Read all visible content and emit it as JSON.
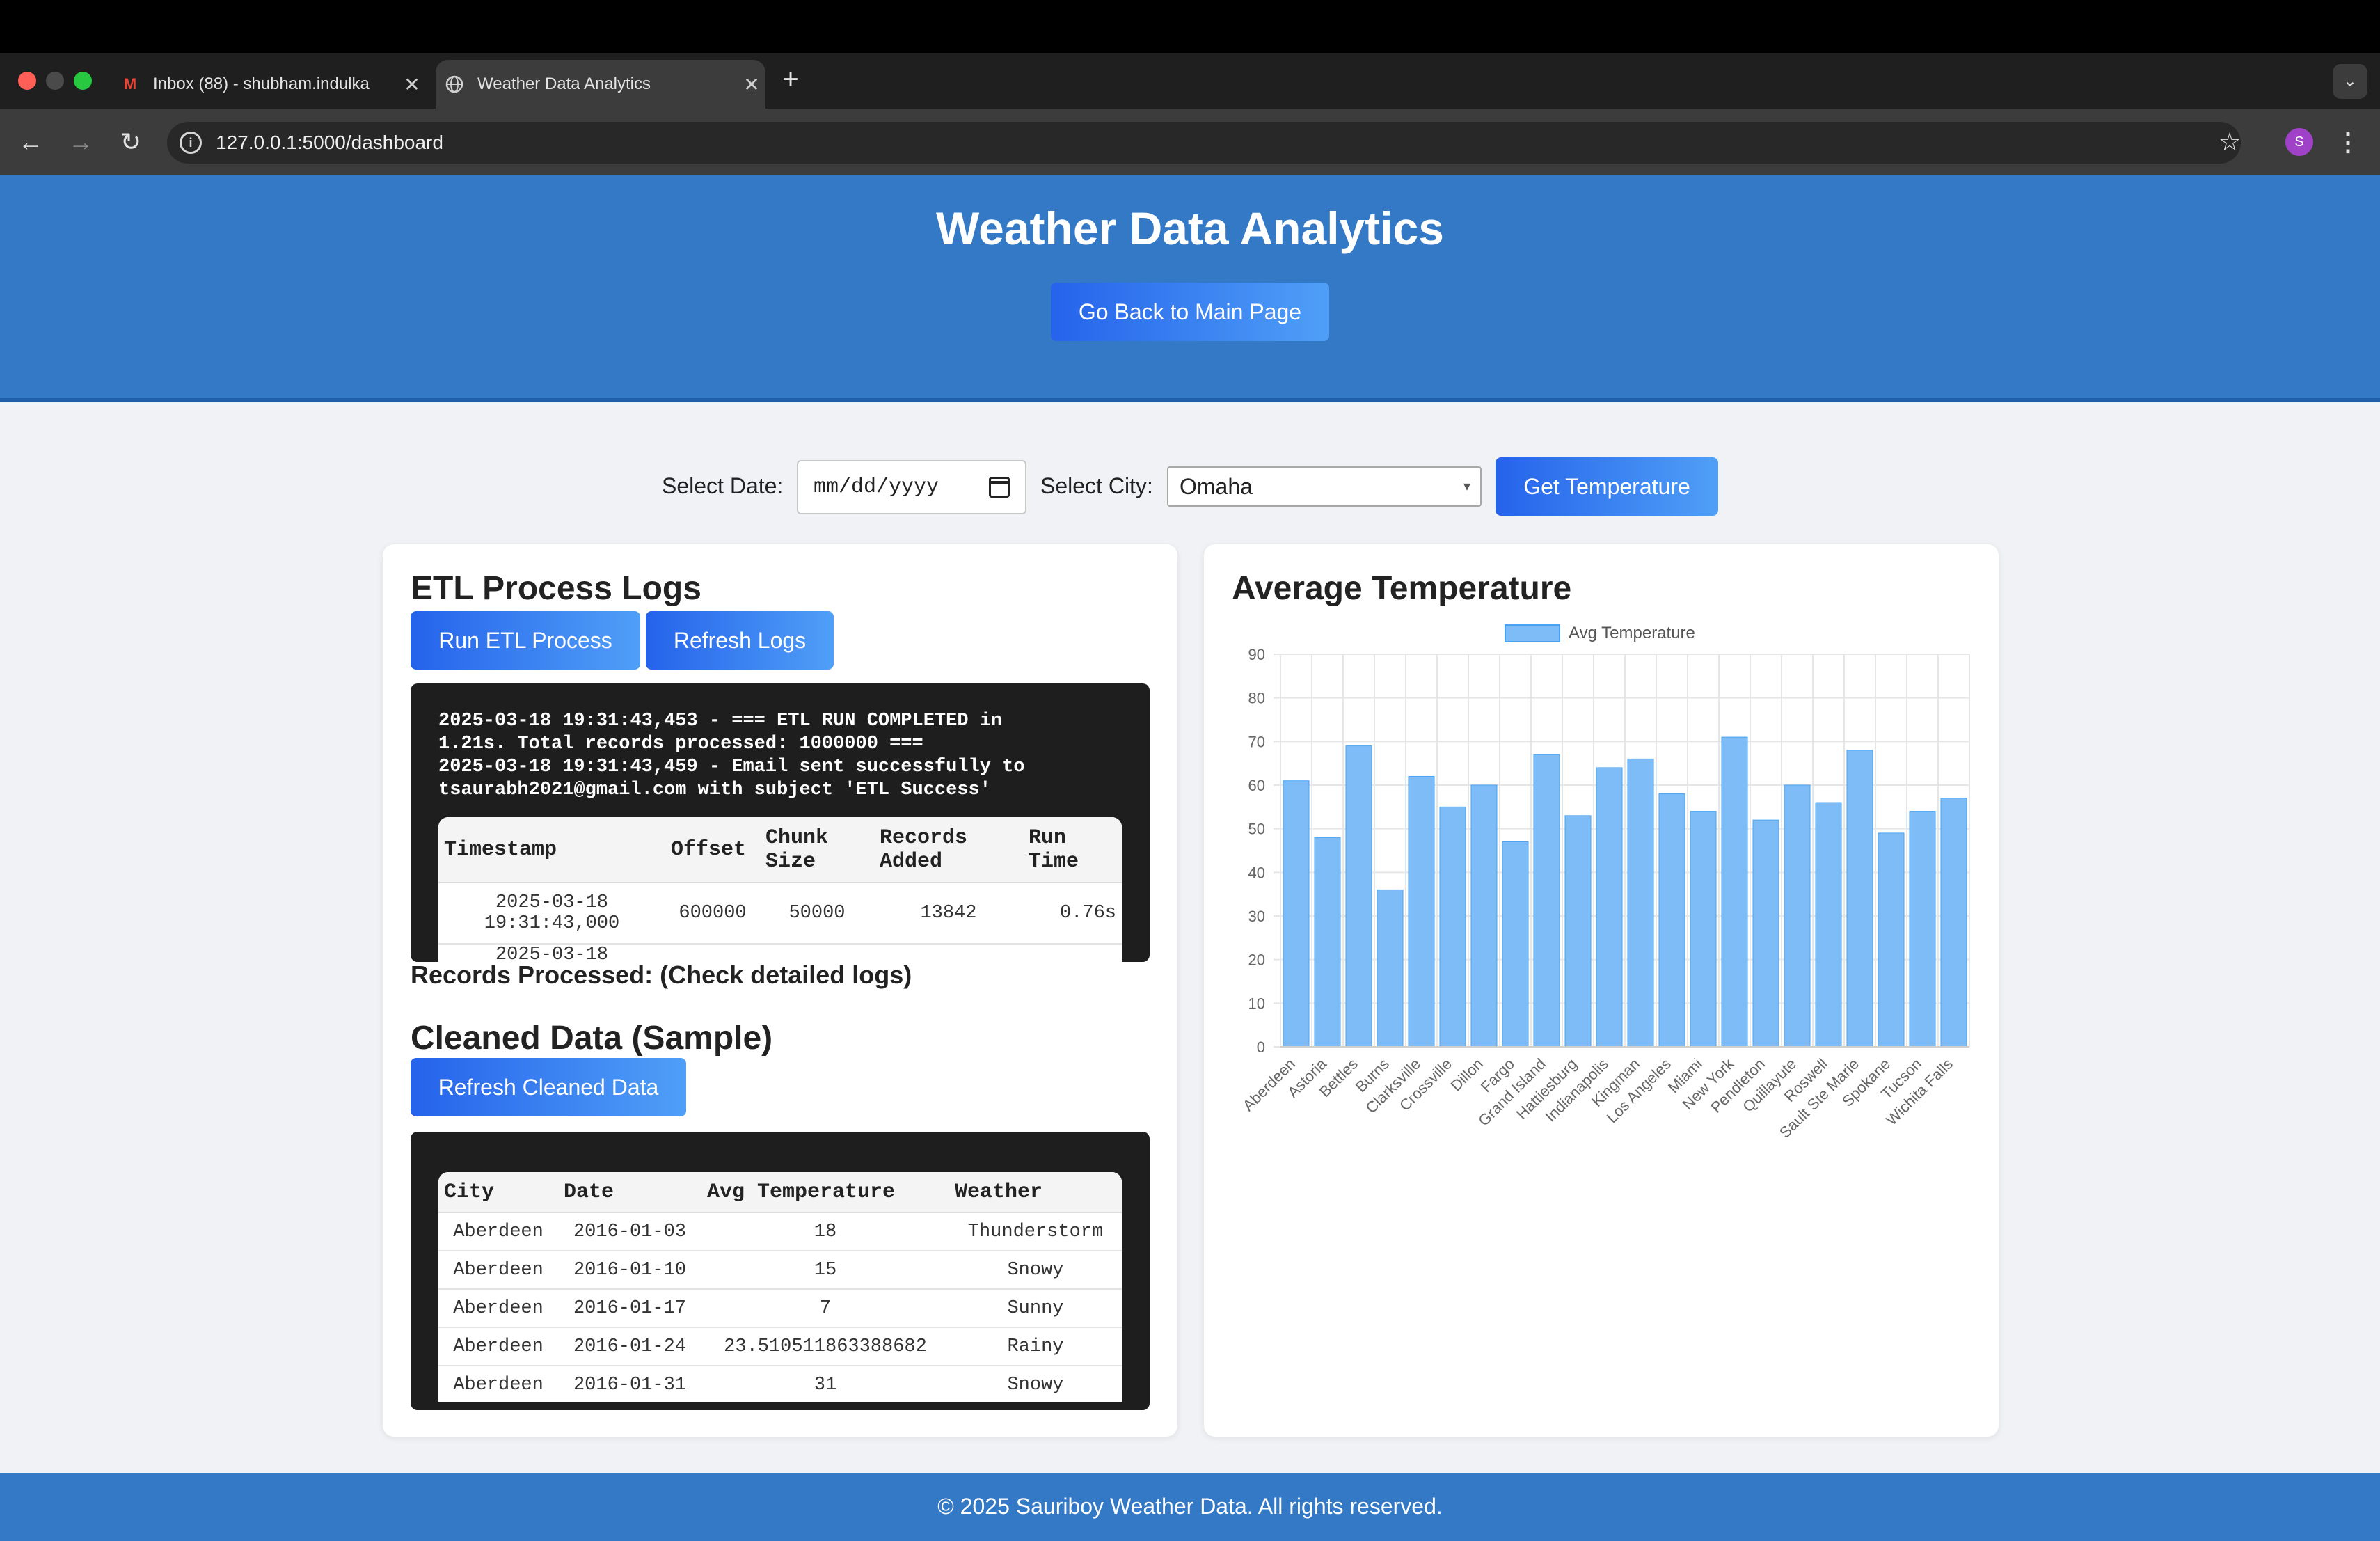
{
  "browser": {
    "tabs": [
      {
        "title": "Inbox (88) - shubham.indulka",
        "icon": "gmail-icon",
        "active": false
      },
      {
        "title": "Weather Data Analytics",
        "icon": "globe-icon",
        "active": true
      }
    ],
    "new_tab": "+",
    "tab_menu": "⌄",
    "url": "127.0.0.1:5000/dashboard",
    "profile_initial": "S"
  },
  "header": {
    "title": "Weather Data Analytics",
    "back_button": "Go Back to Main Page"
  },
  "controls": {
    "date_label": "Select Date:",
    "date_placeholder": "mm/dd/yyyy",
    "city_label": "Select City:",
    "city_value": "Omaha",
    "get_button": "Get Temperature"
  },
  "etl": {
    "title": "ETL Process Logs",
    "run_button": "Run ETL Process",
    "refresh_button": "Refresh Logs",
    "log_text": "2025-03-18 19:31:43,453 - === ETL RUN COMPLETED in\n1.21s. Total records processed: 1000000 ===\n2025-03-18 19:31:43,459 - Email sent successfully to\ntsaurabh2021@gmail.com with subject 'ETL Success'",
    "table": {
      "headers": [
        "Timestamp",
        "Offset",
        "Chunk Size",
        "Records Added",
        "Run Time"
      ],
      "rows": [
        [
          "2025-03-18 19:31:43,000",
          "600000",
          "50000",
          "13842",
          "0.76s"
        ],
        [
          "2025-03-18",
          "",
          "",
          "",
          ""
        ]
      ]
    },
    "records_processed": "Records Processed: (Check detailed logs)"
  },
  "cleaned": {
    "title": "Cleaned Data (Sample)",
    "refresh_button": "Refresh Cleaned Data",
    "table": {
      "headers": [
        "City",
        "Date",
        "Avg Temperature",
        "Weather"
      ],
      "rows": [
        [
          "Aberdeen",
          "2016-01-03",
          "18",
          "Thunderstorm"
        ],
        [
          "Aberdeen",
          "2016-01-10",
          "15",
          "Snowy"
        ],
        [
          "Aberdeen",
          "2016-01-17",
          "7",
          "Sunny"
        ],
        [
          "Aberdeen",
          "2016-01-24",
          "23.510511863388682",
          "Rainy"
        ],
        [
          "Aberdeen",
          "2016-01-31",
          "31",
          "Snowy"
        ]
      ]
    }
  },
  "avg_chart": {
    "title": "Average Temperature"
  },
  "chart_data": {
    "type": "bar",
    "title": "",
    "legend": "Avg Temperature",
    "legend_position": "top",
    "ylim": [
      0,
      90
    ],
    "yticks": [
      0,
      10,
      20,
      30,
      40,
      50,
      60,
      70,
      80,
      90
    ],
    "grid": true,
    "bar_color": "#7ebcf7",
    "categories": [
      "Aberdeen",
      "Astoria",
      "Bettles",
      "Burns",
      "Clarksville",
      "Crossville",
      "Dillon",
      "Fargo",
      "Grand Island",
      "Hattiesburg",
      "Indianapolis",
      "Kingman",
      "Los Angeles",
      "Miami",
      "New York",
      "Pendleton",
      "Quillayute",
      "Roswell",
      "Sault Ste Marie",
      "Spokane",
      "Tucson",
      "Wichita Falls"
    ],
    "values": [
      61,
      48,
      69,
      36,
      62,
      55,
      60,
      47,
      67,
      53,
      64,
      66,
      58,
      54,
      71,
      52,
      60,
      56,
      68,
      49,
      54,
      57
    ]
  },
  "footer": {
    "text": "© 2025 Sauriboy Weather Data. All rights reserved."
  }
}
